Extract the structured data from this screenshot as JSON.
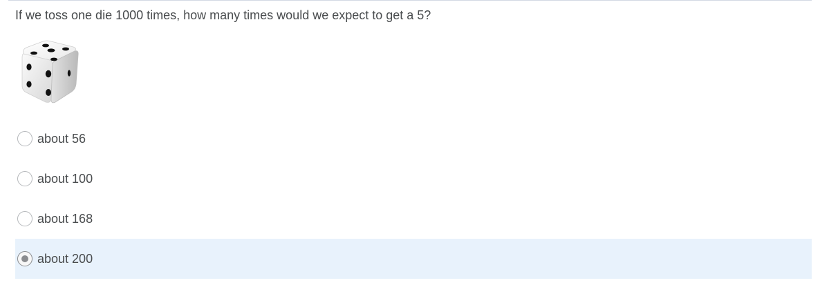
{
  "question": {
    "text": "If we toss one die 1000 times, how many times would we expect to get a 5?"
  },
  "image": {
    "icon": "die-icon"
  },
  "options": [
    {
      "label": "about 56",
      "selected": false
    },
    {
      "label": "about 100",
      "selected": false
    },
    {
      "label": "about 168",
      "selected": false
    },
    {
      "label": "about 200",
      "selected": true
    }
  ],
  "colors": {
    "text": "#494c4e",
    "selected_background": "#e8f2fc",
    "radio_border": "#b4b7ba",
    "radio_dot": "#8a8c8f"
  }
}
